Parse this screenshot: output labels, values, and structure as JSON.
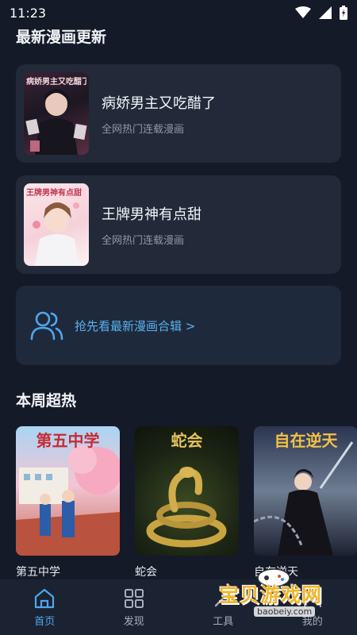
{
  "status": {
    "time": "11:23"
  },
  "latest_section": {
    "title": "最新漫画更新"
  },
  "latest_items": [
    {
      "cover_title": "病娇男主又吃醋了",
      "title": "病娇男主又吃醋了",
      "subtitle": "全网热门连载漫画"
    },
    {
      "cover_title": "王牌男神有点甜",
      "title": "王牌男神有点甜",
      "subtitle": "全网热门连载漫画"
    }
  ],
  "promo": {
    "label": "抢先看最新漫画合辑 >"
  },
  "hot_section": {
    "title": "本周超热"
  },
  "hot_items": [
    {
      "cover_title": "第五中学",
      "name": "第五中学"
    },
    {
      "cover_title": "蛇会",
      "name": "蛇会"
    },
    {
      "cover_title": "自在逆天",
      "name": "自在逆天"
    }
  ],
  "nav": [
    {
      "label": "首页",
      "icon": "home-icon",
      "active": true
    },
    {
      "label": "发现",
      "icon": "grid-icon",
      "active": false
    },
    {
      "label": "工具",
      "icon": "tools-icon",
      "active": false
    },
    {
      "label": "我的",
      "icon": "user-icon",
      "active": false
    }
  ],
  "watermark": {
    "text": "宝贝游戏网",
    "url": "baobeiy.com"
  },
  "colors": {
    "background": "#141a28",
    "card": "#222a3a",
    "accent": "#4ea7ec"
  }
}
